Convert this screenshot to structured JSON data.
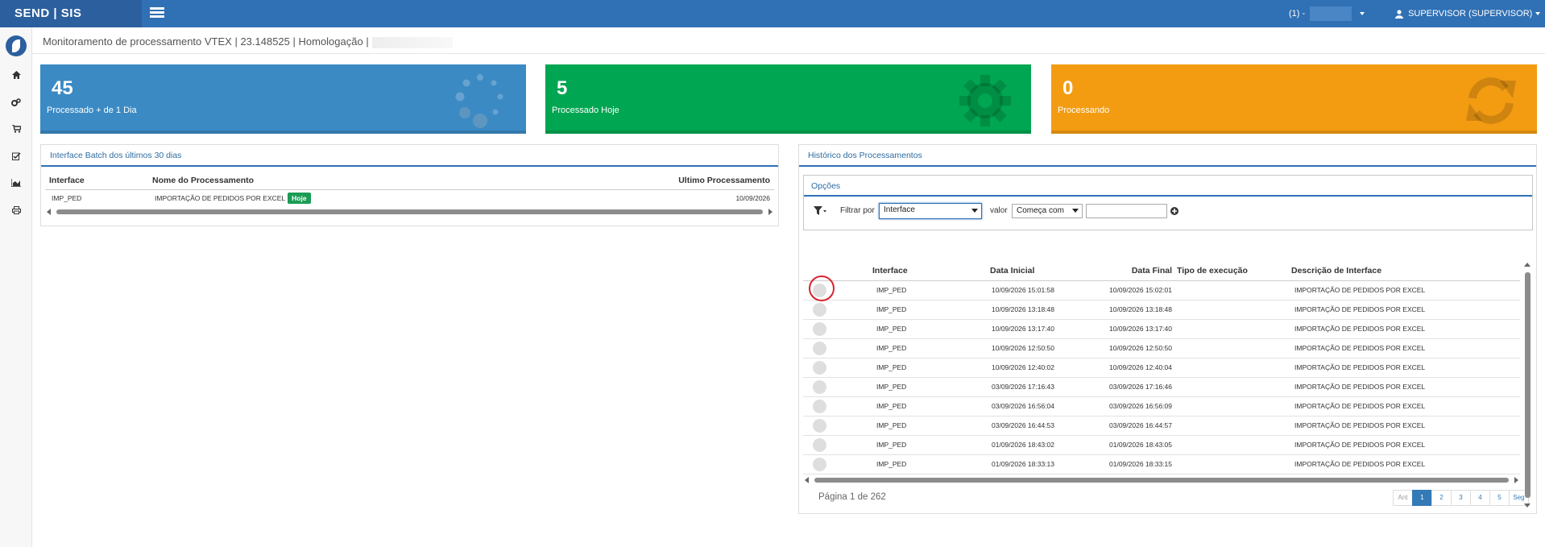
{
  "topbar": {
    "brand": "SEND | SIS",
    "env_label": "(1) -",
    "user_label": "SUPERVISOR (SUPERVISOR)"
  },
  "sidebar": {
    "icons": [
      "home-icon",
      "cogs-icon",
      "cart-icon",
      "checklist-icon",
      "chart-icon",
      "print-icon"
    ]
  },
  "page": {
    "title": "Monitoramento de processamento VTEX | 23.148525 | Homologação |"
  },
  "stats": [
    {
      "value": "45",
      "label": "Processado + de 1 Dia",
      "color": "#3b8ac4",
      "icon": "spinner-icon"
    },
    {
      "value": "5",
      "label": "Processado Hoje",
      "color": "#00a651",
      "icon": "gear-icon"
    },
    {
      "value": "0",
      "label": "Processando",
      "color": "#f39c12",
      "icon": "refresh-icon"
    }
  ],
  "batch_panel": {
    "title": "Interface Batch dos últimos 30 dias",
    "columns": [
      "Interface",
      "Nome do Processamento",
      "Ultimo Processamento"
    ],
    "rows": [
      {
        "interface": "IMP_PED",
        "name": "IMPORTAÇÃO DE PEDIDOS POR EXCEL",
        "badge": "Hoje",
        "last": "10/09/2026"
      }
    ]
  },
  "history_panel": {
    "title": "Histórico dos Processamentos",
    "options_title": "Opções",
    "filter": {
      "filter_by_label": "Filtrar por",
      "filter_by_value": "Interface",
      "value_label": "valor",
      "operator_value": "Começa com",
      "text_value": ""
    },
    "columns": [
      "Interface",
      "Data Inicial",
      "Data Final",
      "Tipo de execução",
      "Descrição de Interface"
    ],
    "rows": [
      {
        "interface": "IMP_PED",
        "start": "10/09/2026 15:01:58",
        "end": "10/09/2026 15:02:01",
        "type": "",
        "desc": "IMPORTAÇÃO DE PEDIDOS POR EXCEL"
      },
      {
        "interface": "IMP_PED",
        "start": "10/09/2026 13:18:48",
        "end": "10/09/2026 13:18:48",
        "type": "",
        "desc": "IMPORTAÇÃO DE PEDIDOS POR EXCEL"
      },
      {
        "interface": "IMP_PED",
        "start": "10/09/2026 13:17:40",
        "end": "10/09/2026 13:17:40",
        "type": "",
        "desc": "IMPORTAÇÃO DE PEDIDOS POR EXCEL"
      },
      {
        "interface": "IMP_PED",
        "start": "10/09/2026 12:50:50",
        "end": "10/09/2026 12:50:50",
        "type": "",
        "desc": "IMPORTAÇÃO DE PEDIDOS POR EXCEL"
      },
      {
        "interface": "IMP_PED",
        "start": "10/09/2026 12:40:02",
        "end": "10/09/2026 12:40:04",
        "type": "",
        "desc": "IMPORTAÇÃO DE PEDIDOS POR EXCEL"
      },
      {
        "interface": "IMP_PED",
        "start": "03/09/2026 17:16:43",
        "end": "03/09/2026 17:16:46",
        "type": "",
        "desc": "IMPORTAÇÃO DE PEDIDOS POR EXCEL"
      },
      {
        "interface": "IMP_PED",
        "start": "03/09/2026 16:56:04",
        "end": "03/09/2026 16:56:09",
        "type": "",
        "desc": "IMPORTAÇÃO DE PEDIDOS POR EXCEL"
      },
      {
        "interface": "IMP_PED",
        "start": "03/09/2026 16:44:53",
        "end": "03/09/2026 16:44:57",
        "type": "",
        "desc": "IMPORTAÇÃO DE PEDIDOS POR EXCEL"
      },
      {
        "interface": "IMP_PED",
        "start": "01/09/2026 18:43:02",
        "end": "01/09/2026 18:43:05",
        "type": "",
        "desc": "IMPORTAÇÃO DE PEDIDOS POR EXCEL"
      },
      {
        "interface": "IMP_PED",
        "start": "01/09/2026 18:33:13",
        "end": "01/09/2026 18:33:15",
        "type": "",
        "desc": "IMPORTAÇÃO DE PEDIDOS POR EXCEL"
      }
    ],
    "page_info": "Página 1 de 262",
    "pager": [
      "Ant",
      "1",
      "2",
      "3",
      "4",
      "5",
      "Seg"
    ],
    "active_page": "1"
  }
}
